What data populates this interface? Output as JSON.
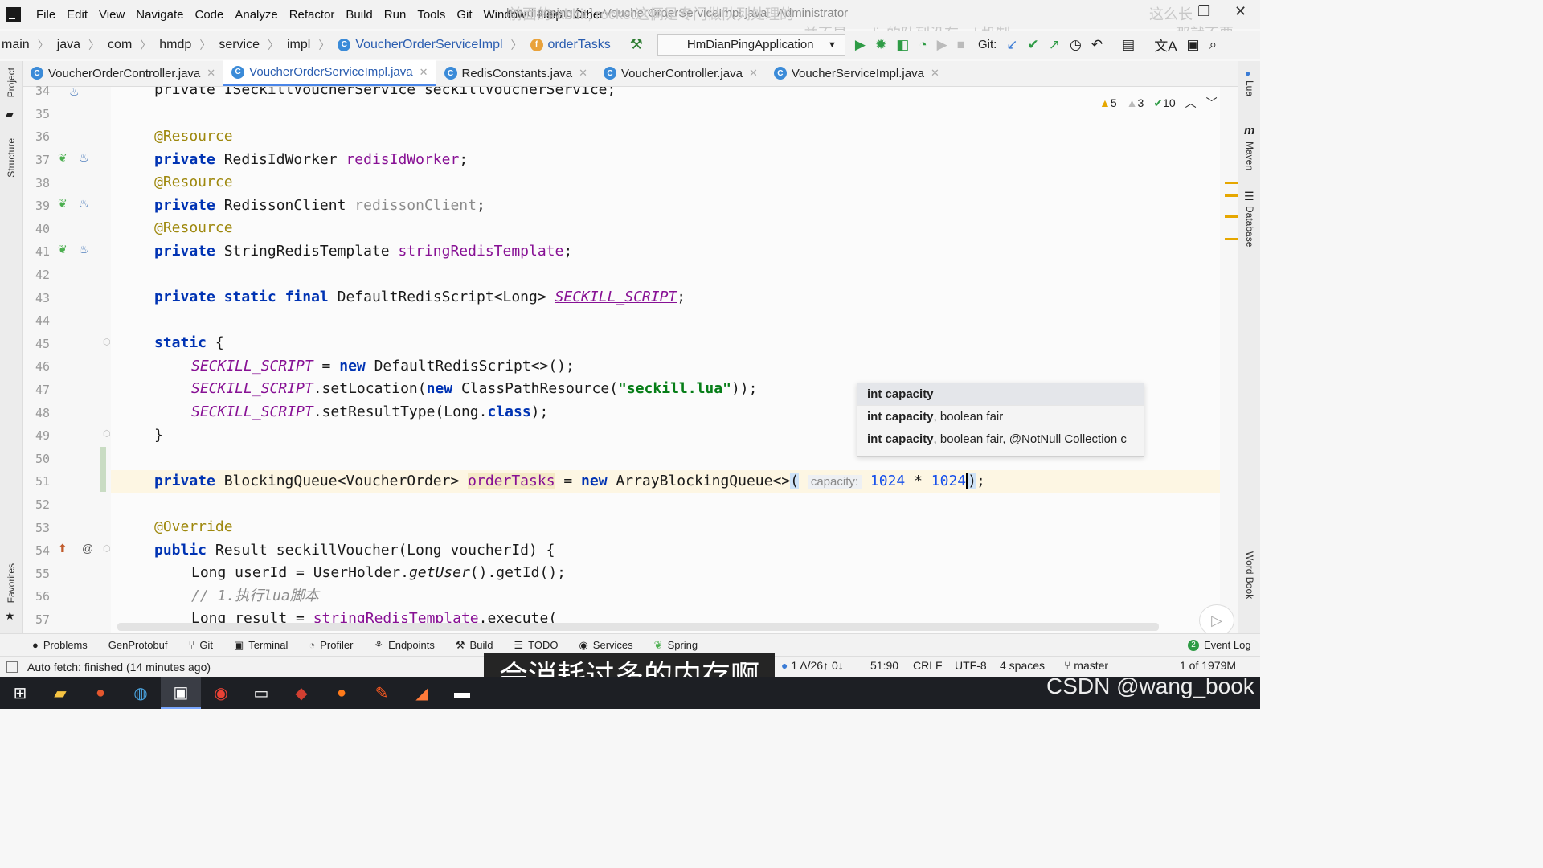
{
  "menubar": {
    "items": [
      "File",
      "Edit",
      "View",
      "Navigate",
      "Code",
      "Analyze",
      "Refactor",
      "Build",
      "Run",
      "Tools",
      "Git",
      "Window",
      "Help",
      "Other"
    ],
    "window_title": "hm-dianping [...] - VoucherOrderServiceImpl.java - Administrator",
    "overlay_line1": "前面的rabbit, rocket这俩是专门做队列处理的",
    "overlay_line2": "并不是, redis的队列没有ack机制",
    "overlay_right1": "这么长",
    "overlay_right2": "那就不要"
  },
  "breadcrumb": {
    "items": [
      "main",
      "java",
      "com",
      "hmdp",
      "service",
      "impl"
    ],
    "class_name": "VoucherOrderServiceImpl",
    "field_name": "orderTasks"
  },
  "toolbar": {
    "run_config": "HmDianPingApplication",
    "git_label": "Git:"
  },
  "tabs": [
    {
      "label": "VoucherOrderController.java",
      "active": false
    },
    {
      "label": "VoucherOrderServiceImpl.java",
      "active": true
    },
    {
      "label": "RedisConstants.java",
      "active": false
    },
    {
      "label": "VoucherController.java",
      "active": false
    },
    {
      "label": "VoucherServiceImpl.java",
      "active": false
    }
  ],
  "left_panels": [
    "Project",
    "Structure",
    "Favorites"
  ],
  "right_panels": [
    "Lua",
    "Maven",
    "Database",
    "Word Book"
  ],
  "inspections": {
    "warnings": "5",
    "weak_warnings": "3",
    "ok": "10"
  },
  "line_numbers": [
    "34",
    "35",
    "36",
    "37",
    "38",
    "39",
    "40",
    "41",
    "42",
    "43",
    "44",
    "45",
    "46",
    "47",
    "48",
    "49",
    "50",
    "51",
    "52",
    "53",
    "54",
    "55",
    "56",
    "57"
  ],
  "code": {
    "l34": "private ISeckillVoucherService seckillVoucherService;",
    "annotation_resource": "@Resource",
    "annotation_override": "@Override",
    "kw_private": "private",
    "kw_static": "static",
    "kw_final": "final",
    "kw_new": "new",
    "kw_public": "public",
    "kw_class": "class",
    "l37_type": "RedisIdWorker",
    "l37_field": "redisIdWorker",
    "l39_type": "RedissonClient",
    "l39_field": "redissonClient",
    "l41_type": "StringRedisTemplate",
    "l41_field": "stringRedisTemplate",
    "l43_type": "DefaultRedisScript<Long>",
    "seckill_script": "SECKILL_SCRIPT",
    "l46_rest": " = ",
    "l46_ctor": "DefaultRedisScript<>();",
    "l47_call": ".setLocation(",
    "l47_ctor": "ClassPathResource(",
    "l47_str": "\"seckill.lua\"",
    "l47_end": "));",
    "l48_call": ".setResultType(Long.",
    "l48_end": ");",
    "l51_type": "BlockingQueue<VoucherOrder>",
    "l51_field": "orderTasks",
    "l51_eq": " = ",
    "l51_ctor": "ArrayBlockingQueue<>",
    "l51_hint": "capacity:",
    "l51_num1": "1024",
    "l51_op": " * ",
    "l51_num2": "1024",
    "l54_sig": "Result seckillVoucher(Long voucherId) {",
    "l55": "Long userId = UserHolder.",
    "l55_method": "getUser",
    "l55_end": "().getId();",
    "l56": "// 1.执行lua脚本",
    "l57": "Long result = ",
    "l57_field": "stringRedisTemplate",
    "l57_end": ".execute("
  },
  "completion_popup": [
    {
      "bold": "int capacity",
      "rest": ""
    },
    {
      "bold": "int capacity",
      "rest": ", boolean fair"
    },
    {
      "bold": "int capacity",
      "rest": ", boolean fair, @NotNull Collection c"
    }
  ],
  "tool_windows": [
    "Problems",
    "GenProtobuf",
    "Git",
    "Terminal",
    "Profiler",
    "Endpoints",
    "Build",
    "TODO",
    "Services",
    "Spring"
  ],
  "event_log": "Event Log",
  "event_log_count": "2",
  "status": {
    "message": "Auto fetch: finished (14 minutes ago)",
    "vcs_changes": "1 Δ/26↑ 0↓",
    "position": "51:90",
    "line_sep": "CRLF",
    "encoding": "UTF-8",
    "indent": "4 spaces",
    "branch": "master",
    "memory": "1 of 1979M"
  },
  "subtitle": "会消耗过多的内存啊",
  "watermark": "CSDN @wang_book"
}
